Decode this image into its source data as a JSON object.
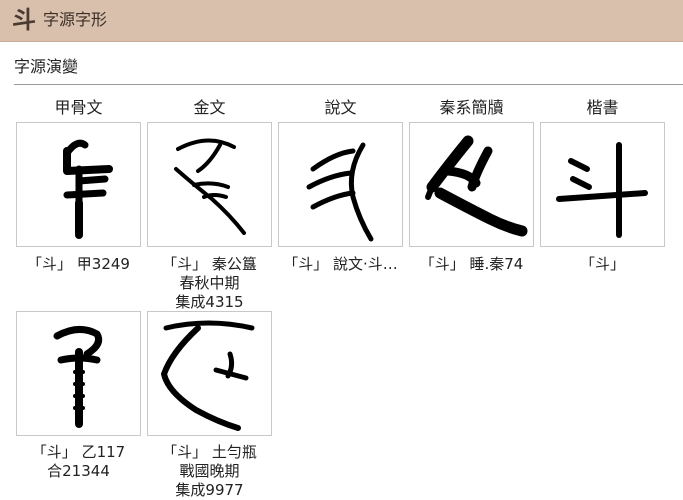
{
  "header": {
    "char": "斗",
    "title": "字源字形"
  },
  "section": {
    "title": "字源演變"
  },
  "columns": [
    "甲骨文",
    "金文",
    "說文",
    "秦系簡牘",
    "楷書"
  ],
  "glyphs": [
    {
      "caption_lines": [
        "「斗」 甲3249"
      ],
      "icon": "oracle-bone-glyph-icon"
    },
    {
      "caption_lines": [
        "「斗」 秦公簋",
        "春秋中期",
        "集成4315"
      ],
      "icon": "bronze-glyph-icon"
    },
    {
      "caption_lines": [
        "「斗」 說文‧斗…"
      ],
      "icon": "shuowen-glyph-icon"
    },
    {
      "caption_lines": [
        "「斗」 睡.秦74"
      ],
      "icon": "bamboo-slip-glyph-icon"
    },
    {
      "caption_lines": [
        "「斗」"
      ],
      "icon": "regular-script-glyph-icon"
    },
    {
      "caption_lines": [
        "「斗」 乙117",
        "合21344"
      ],
      "icon": "oracle-bone-glyph-icon"
    },
    {
      "caption_lines": [
        "「斗」 土勻瓶",
        "戰國晚期",
        "集成9977"
      ],
      "icon": "bronze-glyph-icon"
    }
  ]
}
